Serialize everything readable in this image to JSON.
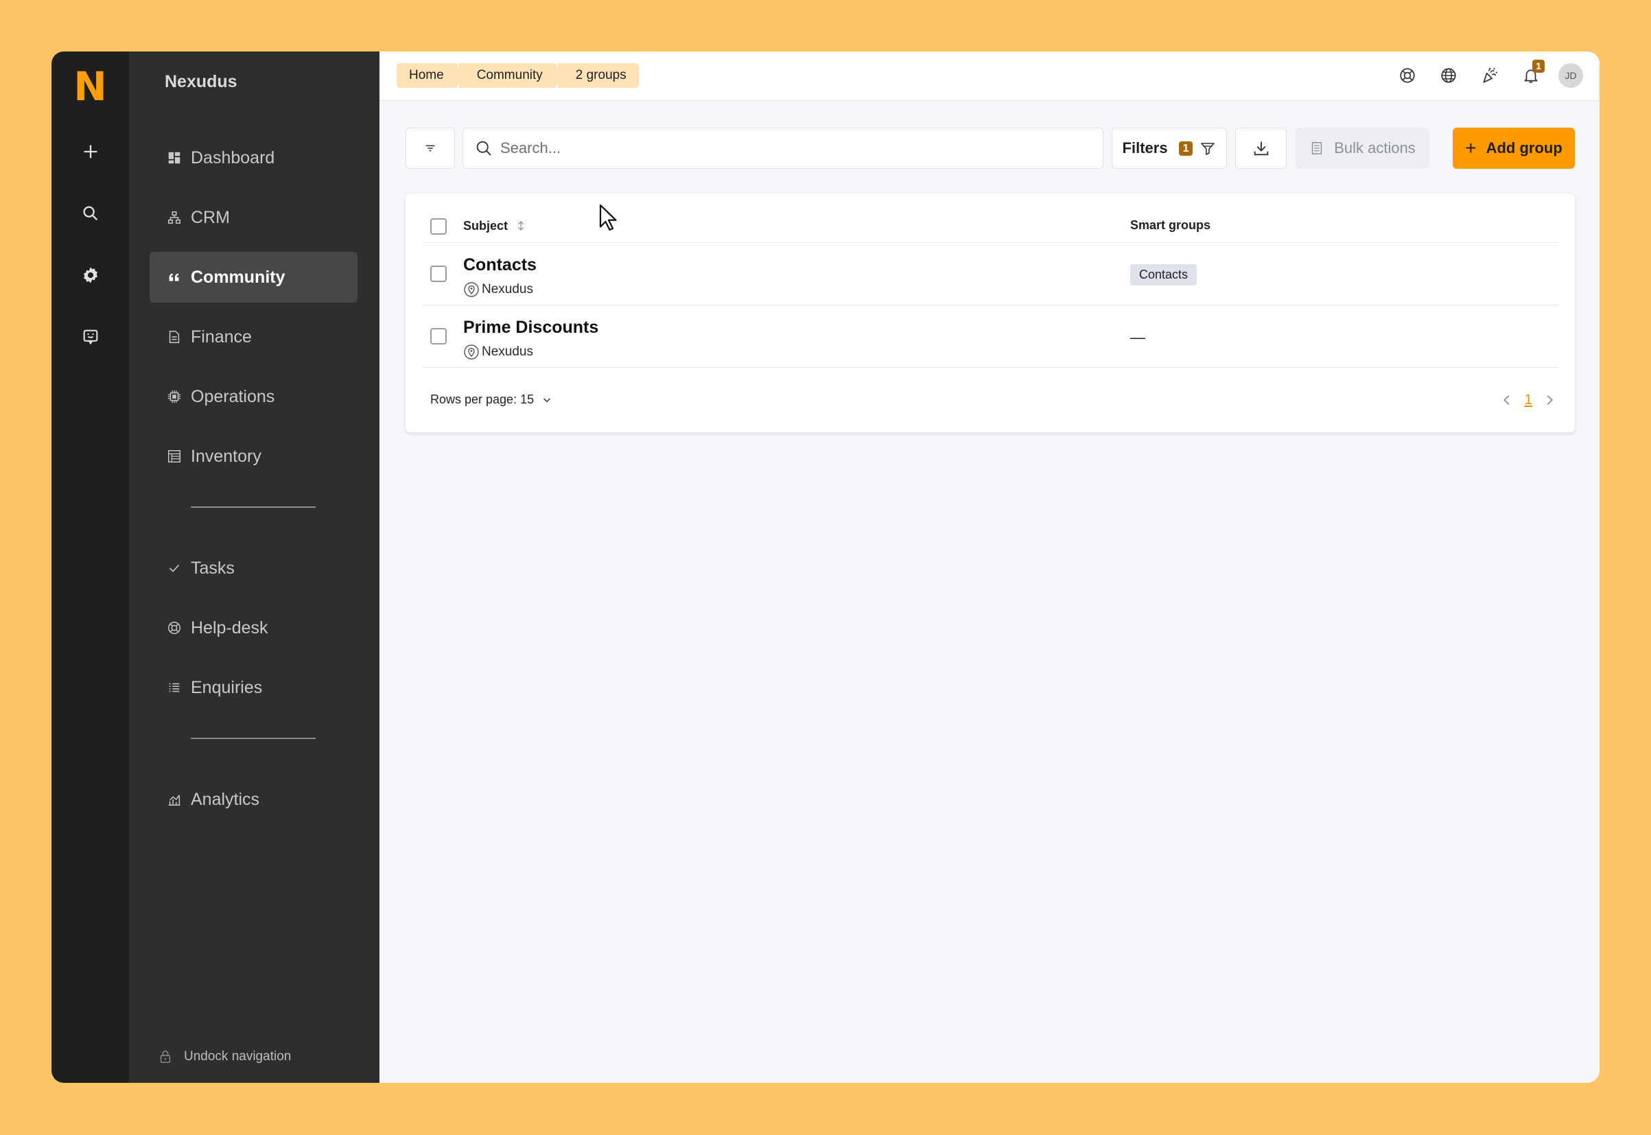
{
  "rail": {
    "logo": "N",
    "icons": [
      "plus-icon",
      "search-icon",
      "gear-icon",
      "chat-icon"
    ]
  },
  "sidebar": {
    "brand": "Nexudus",
    "items": [
      {
        "label": "Dashboard",
        "icon": "dashboard-icon"
      },
      {
        "label": "CRM",
        "icon": "crm-icon"
      },
      {
        "label": "Community",
        "icon": "quote-icon",
        "active": true
      },
      {
        "label": "Finance",
        "icon": "document-icon"
      },
      {
        "label": "Operations",
        "icon": "chip-icon"
      },
      {
        "label": "Inventory",
        "icon": "inventory-icon"
      },
      {
        "label": "Tasks",
        "icon": "check-icon"
      },
      {
        "label": "Help-desk",
        "icon": "lifebuoy-icon"
      },
      {
        "label": "Enquiries",
        "icon": "list-icon"
      },
      {
        "label": "Analytics",
        "icon": "analytics-icon"
      }
    ],
    "undock_label": "Undock navigation"
  },
  "topbar": {
    "breadcrumb": [
      "Home",
      "Community",
      "2 groups"
    ],
    "notification_count": "1",
    "avatar_initials": "JD"
  },
  "toolbar": {
    "search_placeholder": "Search...",
    "filters_label": "Filters",
    "filters_count": "1",
    "bulk_label": "Bulk actions",
    "add_label": "Add group"
  },
  "table": {
    "columns": [
      "Subject",
      "Smart groups"
    ],
    "rows": [
      {
        "title": "Contacts",
        "location": "Nexudus",
        "smart_group": "Contacts"
      },
      {
        "title": "Prime Discounts",
        "location": "Nexudus",
        "smart_group": "—"
      }
    ],
    "rows_per_page": "Rows per page: 15",
    "current_page": "1"
  },
  "colors": {
    "accent": "#ff9a00",
    "background": "#ffc466",
    "sidebar": "#2e2e2e",
    "rail": "#1f1f1f"
  }
}
